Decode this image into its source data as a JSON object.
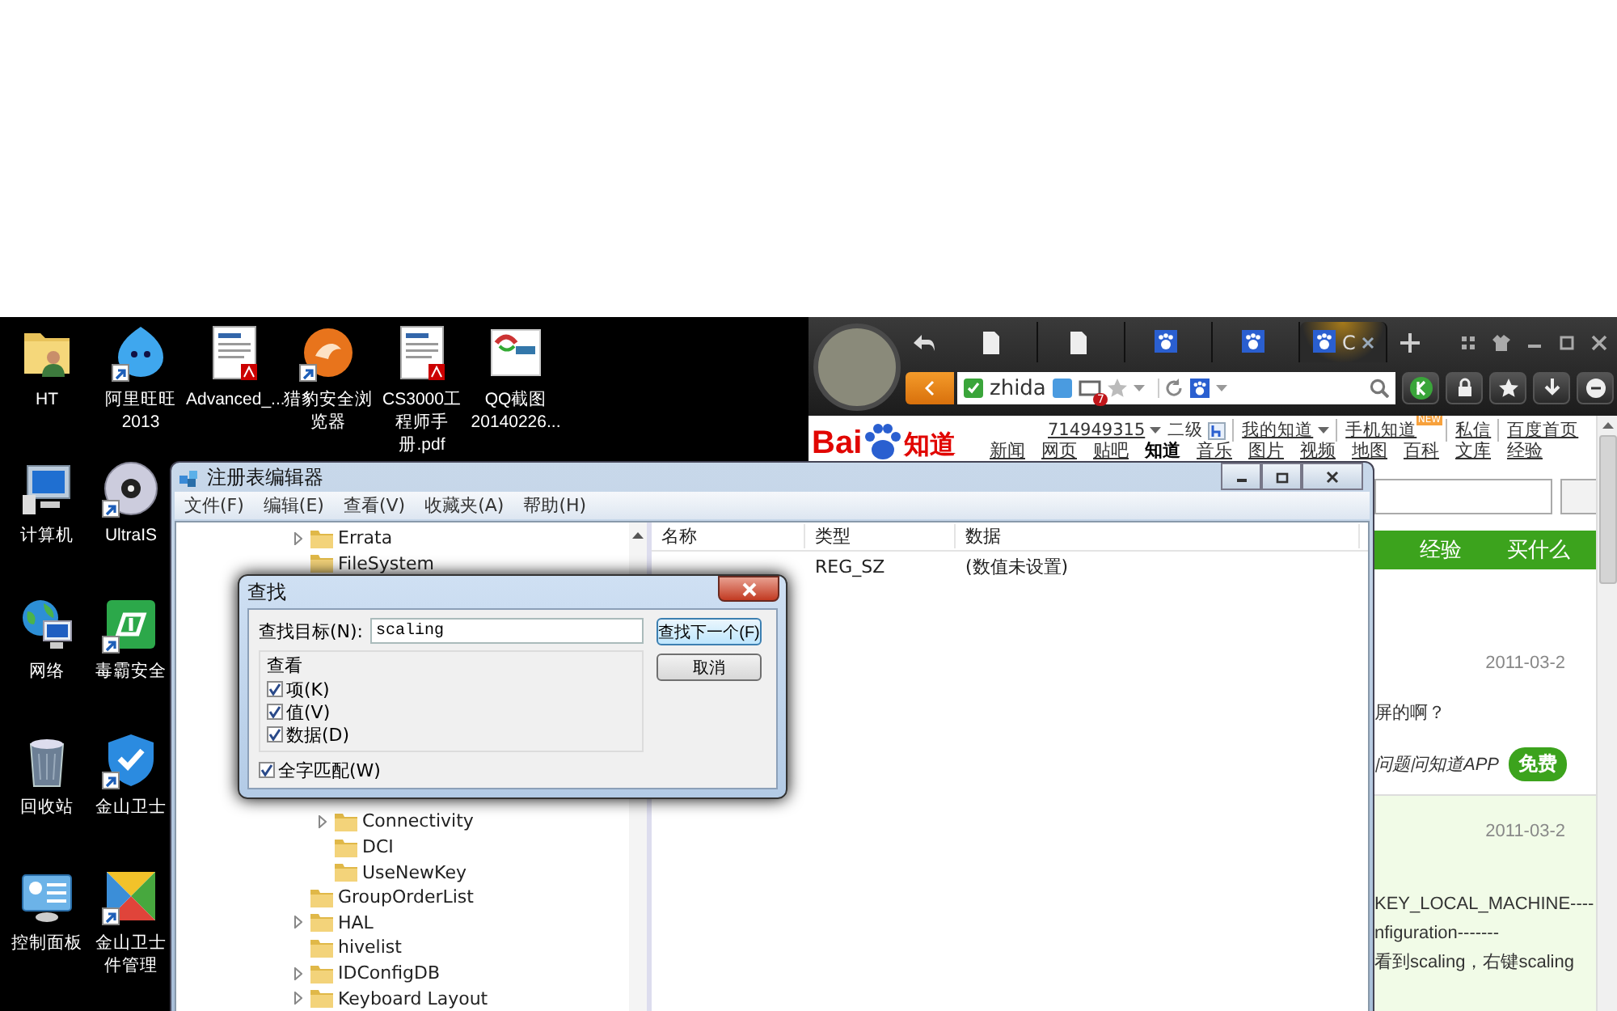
{
  "desktop": {
    "icons": [
      {
        "label": "HT",
        "kind": "user-folder",
        "shortcut": false
      },
      {
        "label": "阿里旺旺 2013",
        "kind": "chat-bubble",
        "shortcut": true
      },
      {
        "label": "Advanced_...",
        "kind": "pdf-document",
        "shortcut": false
      },
      {
        "label": "猎豹安全浏览器",
        "kind": "round-app",
        "shortcut": true
      },
      {
        "label": "CS3000工程师手册.pdf",
        "kind": "pdf-document",
        "shortcut": false
      },
      {
        "label": "QQ截图 20140226...",
        "kind": "image",
        "shortcut": false
      },
      {
        "label": "计算机",
        "kind": "computer",
        "shortcut": false
      },
      {
        "label": "UltraIS",
        "kind": "disc",
        "shortcut": true
      },
      {
        "label": "网络",
        "kind": "network",
        "shortcut": false
      },
      {
        "label": "毒霸安全",
        "kind": "app-tile",
        "shortcut": true
      },
      {
        "label": "回收站",
        "kind": "trash",
        "shortcut": false
      },
      {
        "label": "金山卫士",
        "kind": "shield",
        "shortcut": true
      },
      {
        "label": "控制面板",
        "kind": "control-panel",
        "shortcut": false
      },
      {
        "label": "金山卫士件管理",
        "kind": "color-tile",
        "shortcut": true
      }
    ]
  },
  "browser": {
    "tabs": [
      {
        "kind": "page",
        "selected": false
      },
      {
        "kind": "page",
        "selected": false
      },
      {
        "kind": "paw",
        "selected": false
      },
      {
        "kind": "paw",
        "selected": false
      },
      {
        "kind": "paw",
        "selected": true,
        "label": "C"
      }
    ],
    "address": "zhida",
    "notification_count": "7",
    "logo": {
      "left": "Bai",
      "right": "知道"
    },
    "account": "714949315",
    "level": "二级",
    "links": [
      {
        "label": "我的知道",
        "dropdown": true
      },
      {
        "label": "手机知道",
        "dropdown": false,
        "new_badge": "NEW"
      },
      {
        "label": "私信",
        "dropdown": false
      },
      {
        "label": "百度首页",
        "dropdown": false
      }
    ],
    "nav": [
      {
        "label": "新闻",
        "selected": false
      },
      {
        "label": "网页",
        "selected": false
      },
      {
        "label": "贴吧",
        "selected": false
      },
      {
        "label": "知道",
        "selected": true
      },
      {
        "label": "音乐",
        "selected": false
      },
      {
        "label": "图片",
        "selected": false
      },
      {
        "label": "视频",
        "selected": false
      },
      {
        "label": "地图",
        "selected": false
      },
      {
        "label": "百科",
        "selected": false
      },
      {
        "label": "文库",
        "selected": false
      },
      {
        "label": "经验",
        "selected": false
      }
    ],
    "green_tabs": [
      "经验",
      "买什么"
    ],
    "answers": [
      {
        "date": "2011-03-2",
        "lines": [
          "屏的啊？"
        ],
        "promo": "问题问知道APP",
        "promo_button": "免费",
        "highlight": false
      },
      {
        "date": "2011-03-2",
        "lines": [
          "KEY_LOCAL_MACHINE----",
          "nfiguration-------",
          "看到scaling，右键scaling"
        ],
        "highlight": true
      }
    ]
  },
  "registry_editor": {
    "title": "注册表编辑器",
    "menu": [
      "文件(F)",
      "编辑(E)",
      "查看(V)",
      "收藏夹(A)",
      "帮助(H)"
    ],
    "tree": [
      {
        "label": "Errata",
        "has_children": true
      },
      {
        "label": "FileSystem",
        "has_children": false
      },
      {
        "children": [
          {
            "label": "Connectivity",
            "has_children": true
          },
          {
            "label": "DCI",
            "has_children": false
          },
          {
            "label": "UseNewKey",
            "has_children": false
          }
        ]
      },
      {
        "label": "GroupOrderList",
        "has_children": false
      },
      {
        "label": "HAL",
        "has_children": true
      },
      {
        "label": "hivelist",
        "has_children": false
      },
      {
        "label": "IDConfigDB",
        "has_children": true
      },
      {
        "label": "Keyboard Layout",
        "has_children": true
      }
    ],
    "columns": [
      "名称",
      "类型",
      "数据"
    ],
    "rows": [
      {
        "type": "REG_SZ",
        "data": "(数值未设置)"
      }
    ]
  },
  "find_dialog": {
    "title": "查找",
    "target_label": "查找目标(N):",
    "target_value": "scaling",
    "look_at_label": "查看",
    "options": [
      {
        "label": "项(K)",
        "checked": true
      },
      {
        "label": "值(V)",
        "checked": true
      },
      {
        "label": "数据(D)",
        "checked": true
      }
    ],
    "whole_word": {
      "label": "全字匹配(W)",
      "checked": true
    },
    "buttons": [
      {
        "label": "查找下一个(F)",
        "default": true
      },
      {
        "label": "取消",
        "default": false
      }
    ]
  }
}
